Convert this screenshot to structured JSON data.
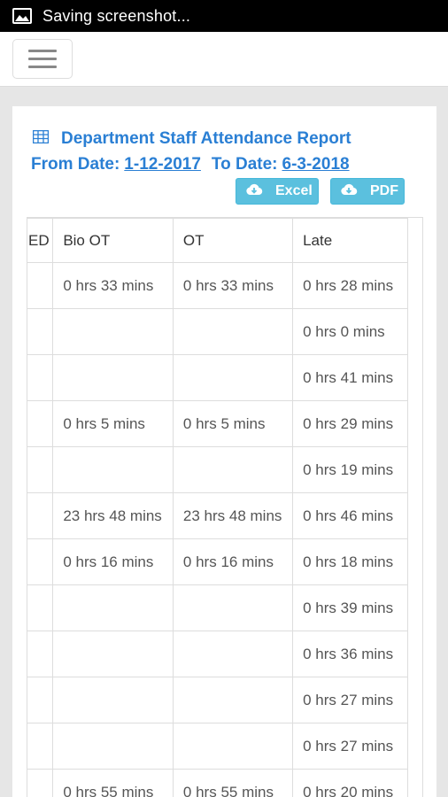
{
  "status_bar": {
    "text": "Saving screenshot..."
  },
  "report": {
    "title": "Department Staff Attendance Report",
    "from_label": "From Date:",
    "from_value": "1-12-2017",
    "to_label": "To Date:",
    "to_value": "6-3-2018",
    "excel_label": "Excel",
    "pdf_label": "PDF"
  },
  "table": {
    "headers": [
      "ED",
      "Bio OT",
      "OT",
      "Late"
    ],
    "rows": [
      [
        "",
        "0 hrs 33 mins",
        "0 hrs 33 mins",
        "0 hrs 28 mins"
      ],
      [
        "",
        "",
        "",
        "0 hrs 0 mins"
      ],
      [
        "",
        "",
        "",
        "0 hrs 41 mins"
      ],
      [
        "",
        "0 hrs 5 mins",
        "0 hrs 5 mins",
        "0 hrs 29 mins"
      ],
      [
        "",
        "",
        "",
        "0 hrs 19 mins"
      ],
      [
        "",
        "23 hrs 48 mins",
        "23 hrs 48 mins",
        "0 hrs 46 mins"
      ],
      [
        "",
        "0 hrs 16 mins",
        "0 hrs 16 mins",
        "0 hrs 18 mins"
      ],
      [
        "",
        "",
        "",
        "0 hrs 39 mins"
      ],
      [
        "",
        "",
        "",
        "0 hrs 36 mins"
      ],
      [
        "",
        "",
        "",
        "0 hrs 27 mins"
      ],
      [
        "",
        "",
        "",
        "0 hrs 27 mins"
      ],
      [
        "",
        "0 hrs 55 mins",
        "0 hrs 55 mins",
        "0 hrs 20 mins"
      ]
    ]
  },
  "colors": {
    "accent": "#2a7fd4",
    "button": "#5bc0de"
  },
  "icons": {
    "status": "image-icon",
    "title": "table-icon",
    "download": "cloud-download-icon"
  }
}
